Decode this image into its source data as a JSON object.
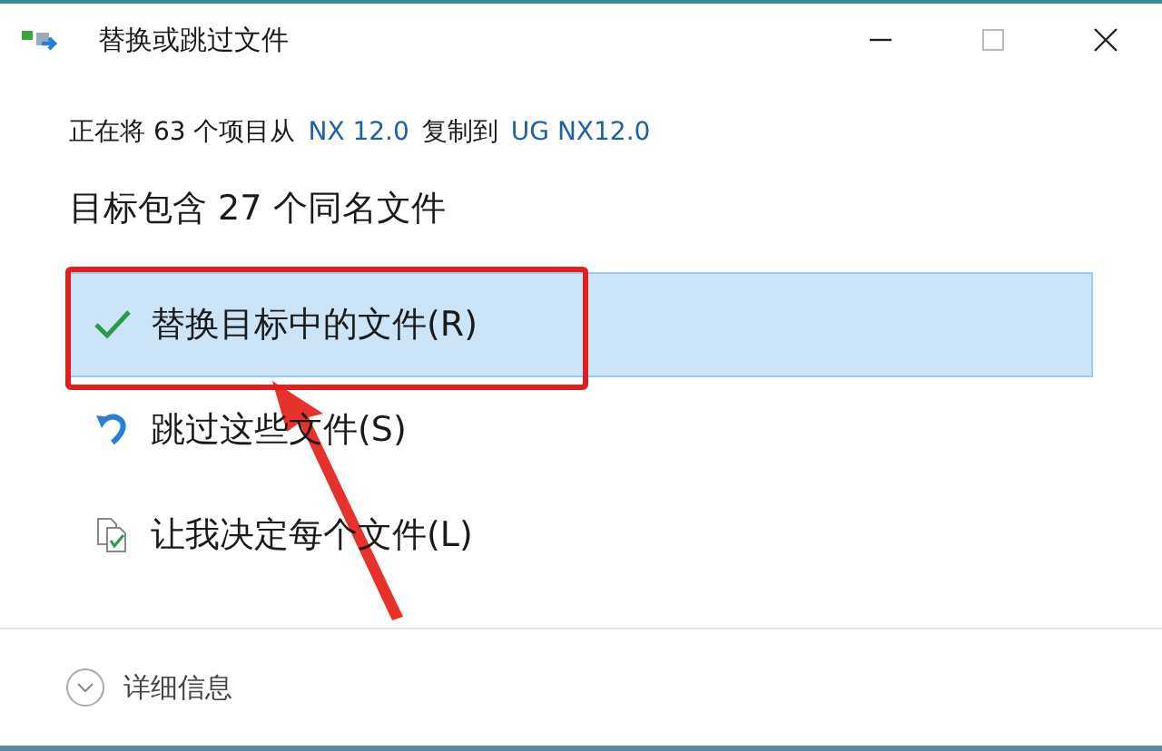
{
  "window": {
    "title": "替换或跳过文件"
  },
  "copy_status": {
    "prefix": "正在将 63 个项目从",
    "source": "NX 12.0",
    "middle": "复制到",
    "destination": "UG NX12.0"
  },
  "heading": "目标包含 27 个同名文件",
  "options": [
    {
      "kind": "replace",
      "label": "替换目标中的文件(R)",
      "selected": true
    },
    {
      "kind": "skip",
      "label": "跳过这些文件(S)",
      "selected": false
    },
    {
      "kind": "decide",
      "label": "让我决定每个文件(L)",
      "selected": false
    }
  ],
  "details": {
    "label": "详细信息",
    "expanded": false
  }
}
